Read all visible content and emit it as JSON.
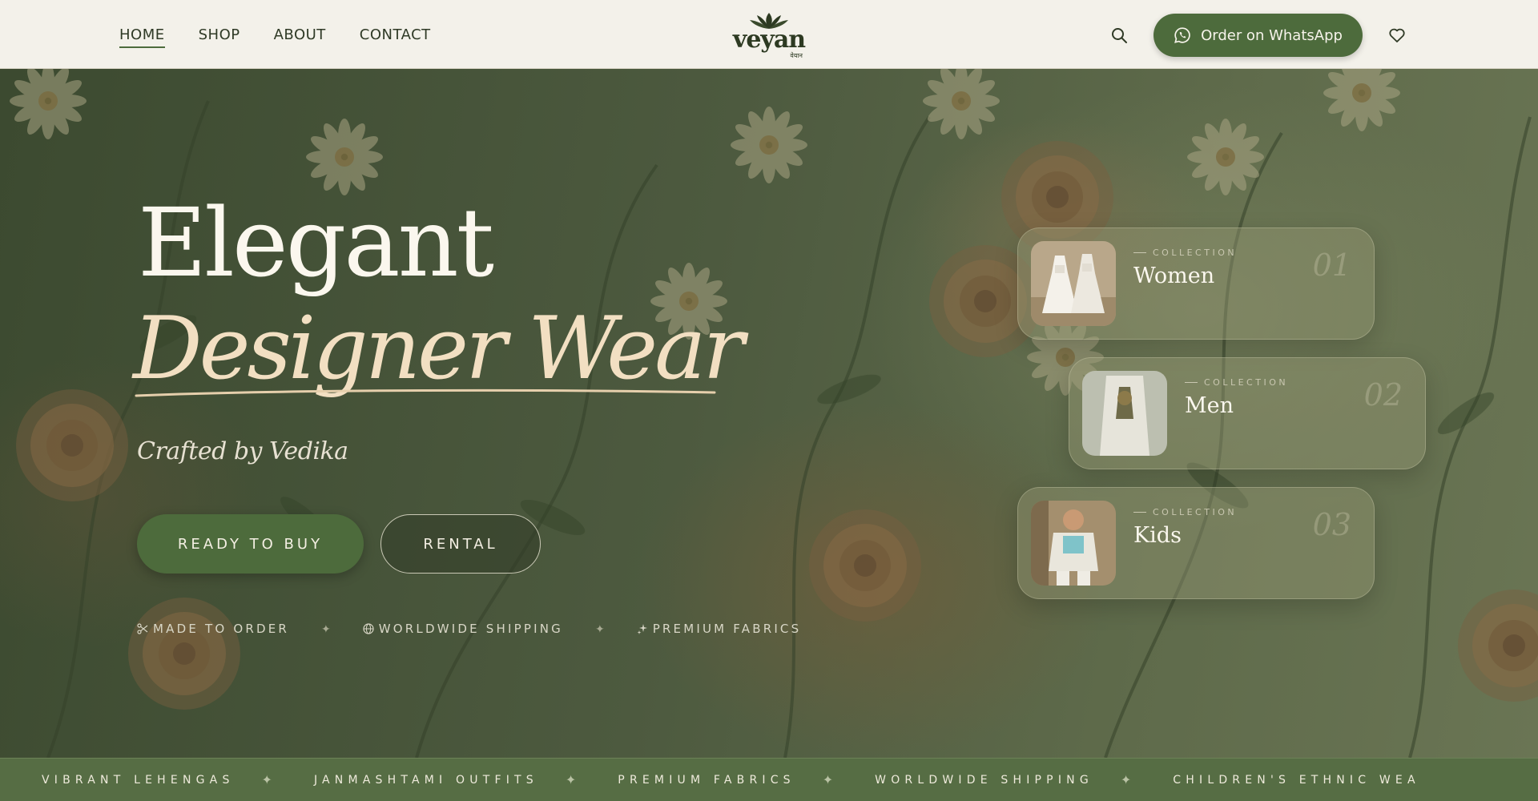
{
  "nav": {
    "items": [
      {
        "label": "HOME",
        "active": true
      },
      {
        "label": "SHOP"
      },
      {
        "label": "ABOUT"
      },
      {
        "label": "CONTACT"
      }
    ]
  },
  "brand": {
    "name": "veyan",
    "subname": "वेयान"
  },
  "header": {
    "whatsapp_label": "Order on WhatsApp",
    "icons": [
      "search-icon",
      "whatsapp-icon",
      "heart-icon"
    ]
  },
  "hero": {
    "title_line1": "Elegant",
    "title_line2": "Designer Wear",
    "subtitle": "Crafted by Vedika",
    "buy_label": "READY TO BUY",
    "rental_label": "RENTAL",
    "features": [
      {
        "label": "MADE TO ORDER",
        "icon": "scissors-icon"
      },
      {
        "label": "WORLDWIDE SHIPPING",
        "icon": "globe-icon"
      },
      {
        "label": "PREMIUM FABRICS",
        "icon": "sparkle-icon"
      }
    ],
    "feature_separator": "✦"
  },
  "collections": [
    {
      "eyebrow": "COLLECTION",
      "title": "Women",
      "number": "01"
    },
    {
      "eyebrow": "COLLECTION",
      "title": "Men",
      "number": "02"
    },
    {
      "eyebrow": "COLLECTION",
      "title": "Kids",
      "number": "03"
    }
  ],
  "marquee": {
    "items": [
      "VIBRANT LEHENGAS",
      "JANMASHTAMI OUTFITS",
      "PREMIUM FABRICS",
      "WORLDWIDE SHIPPING",
      "CHILDREN'S ETHNIC WEA"
    ],
    "separator": "✦"
  },
  "colors": {
    "accent_green": "#4d6b3c",
    "header_bg": "#f3f1ea",
    "hero_bg": "#4a573e",
    "cream_text": "#f2dfc2",
    "marquee_bg": "#566d44"
  }
}
